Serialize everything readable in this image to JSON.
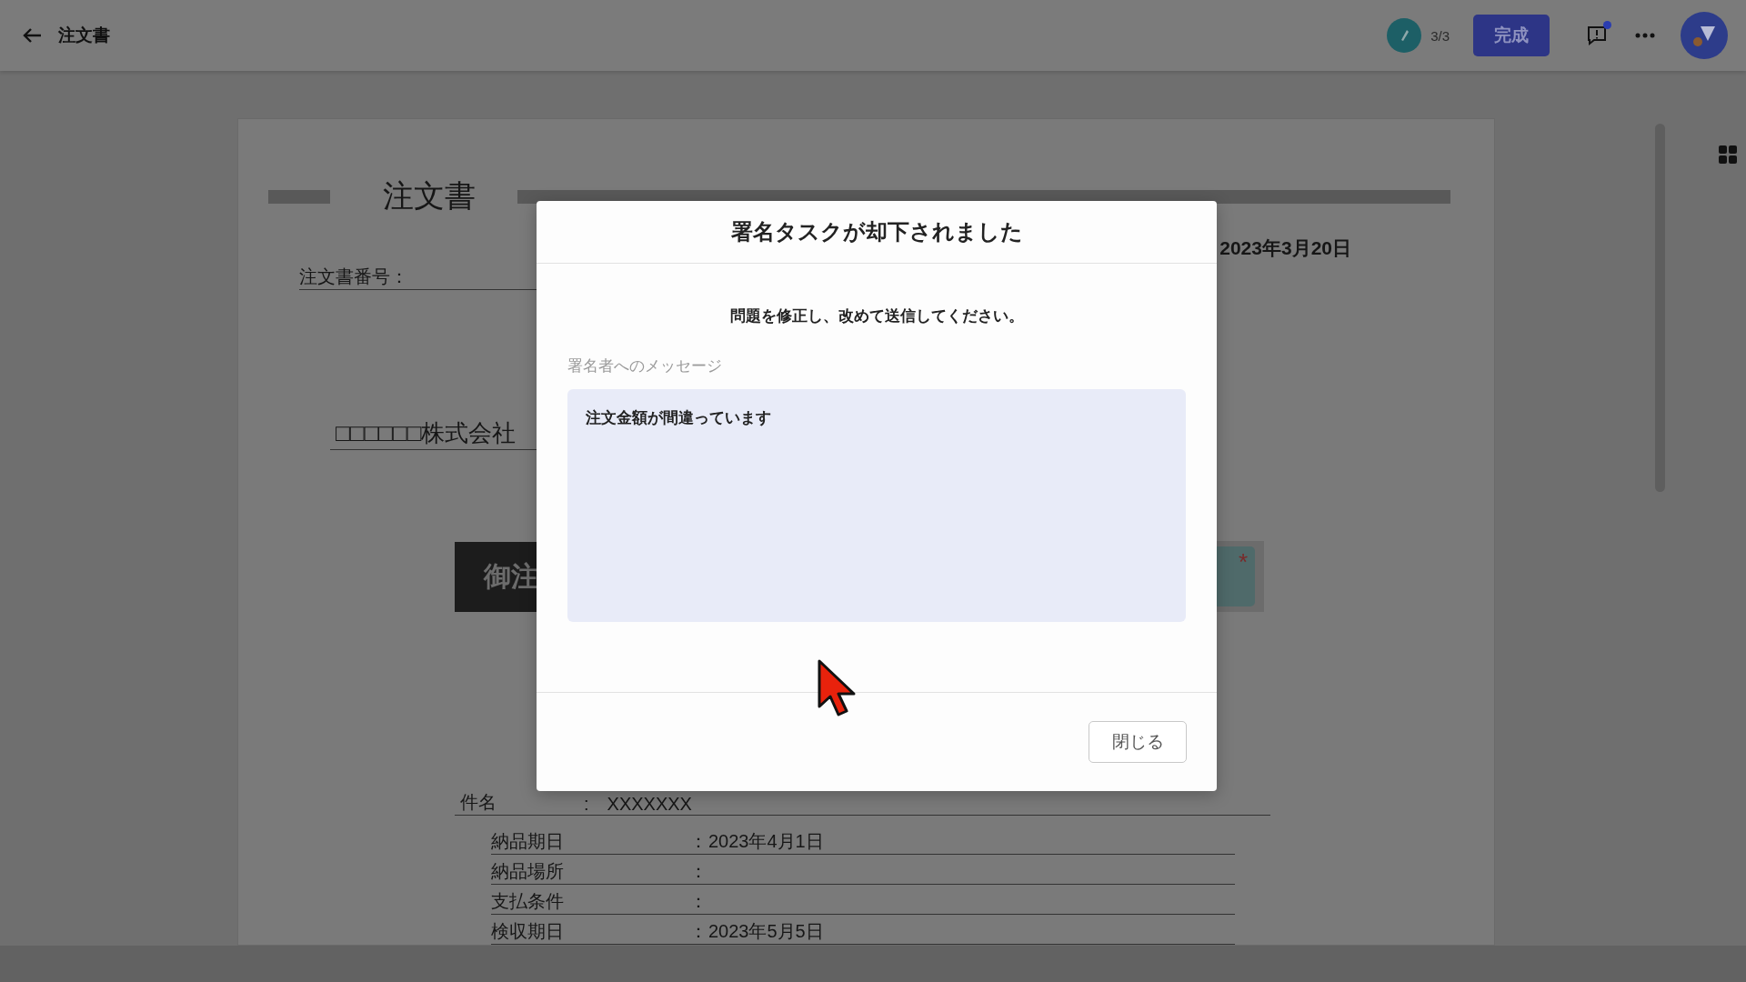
{
  "header": {
    "title": "注文書",
    "progress": "3/3",
    "complete_button": "完成",
    "notification": true
  },
  "document": {
    "title": "注文書",
    "date": "2023年3月20日",
    "number_label": "注文書番号：",
    "company": "□□□□□□株式会社",
    "banner": "御注",
    "signature_required": true,
    "required_mark": "*",
    "subject": {
      "label": "件名",
      "separator": ":",
      "value": "XXXXXXX"
    },
    "fields": [
      {
        "label": "納品期日",
        "separator": "：",
        "value": "2023年4月1日"
      },
      {
        "label": "納品場所",
        "separator": "："
      },
      {
        "label": "支払条件",
        "separator": "："
      },
      {
        "label": "検収期日",
        "separator": "：",
        "value": "2023年5月5日"
      }
    ]
  },
  "dialog": {
    "title": "署名タスクが却下されました",
    "message": "問題を修正し、改めて送信してください。",
    "field_label": "署名者へのメッセージ",
    "field_value": "注文金額が間違っています",
    "close_button": "閉じる"
  }
}
